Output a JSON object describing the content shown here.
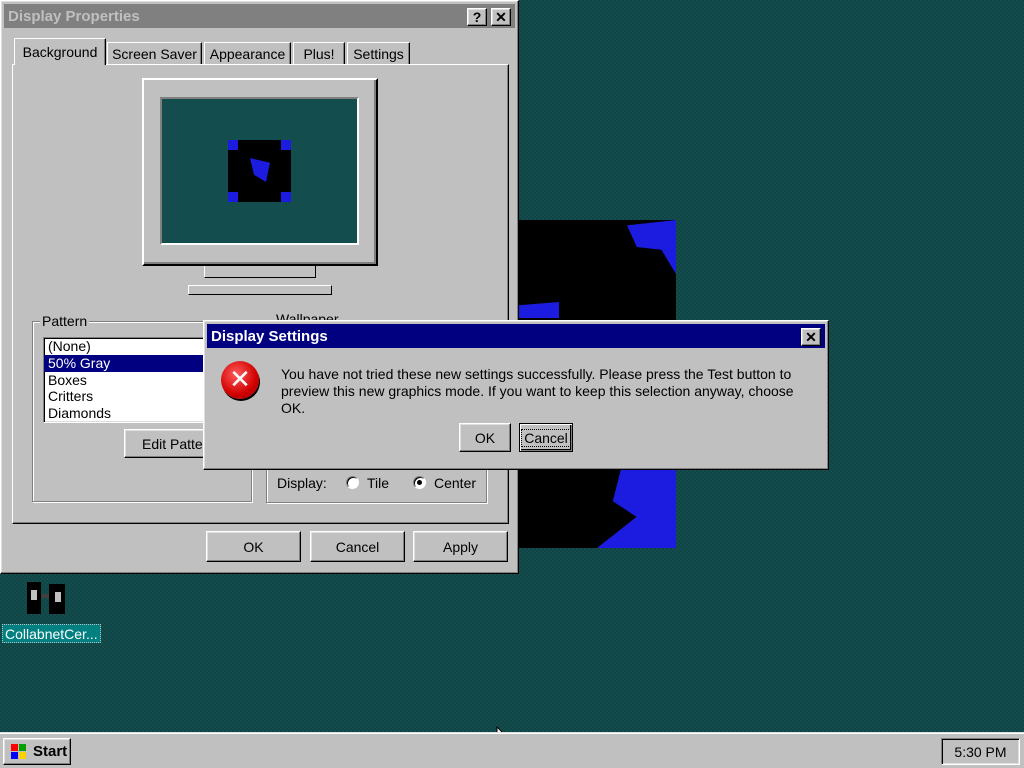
{
  "colors": {
    "desktop": "#134d4d",
    "active_title": "#000080",
    "inactive_title": "#808080",
    "face": "#c0c0c0",
    "error_red": "#d00000",
    "wallpaper_blue": "#1c1ce0"
  },
  "display_properties": {
    "title": "Display Properties",
    "help_label": "?",
    "close_label": "✕",
    "tabs": [
      {
        "label": "Background",
        "active": true
      },
      {
        "label": "Screen Saver",
        "active": false
      },
      {
        "label": "Appearance",
        "active": false
      },
      {
        "label": "Plus!",
        "active": false
      },
      {
        "label": "Settings",
        "active": false
      }
    ],
    "pattern": {
      "label": "Pattern",
      "items": [
        "(None)",
        "50% Gray",
        "Boxes",
        "Critters",
        "Diamonds"
      ],
      "selected": "50% Gray",
      "edit_button": "Edit Patter"
    },
    "wallpaper": {
      "label": "Wallpaper",
      "display_label": "Display:",
      "options": [
        {
          "label": "Tile",
          "checked": false
        },
        {
          "label": "Center",
          "checked": true
        }
      ]
    },
    "buttons": {
      "ok": "OK",
      "cancel": "Cancel",
      "apply": "Apply"
    }
  },
  "modal": {
    "title": "Display Settings",
    "close_label": "✕",
    "icon": "error-icon",
    "message": "You have not tried these new settings successfully. Please press the Test button to preview this new graphics mode. If you want to keep this selection anyway, choose OK.",
    "ok": "OK",
    "cancel": "Cancel"
  },
  "desktop_icon": {
    "label": "CollabnetCer...",
    "icon": "collabnet-icon"
  },
  "taskbar": {
    "start_label": "Start",
    "clock": "5:30 PM"
  }
}
